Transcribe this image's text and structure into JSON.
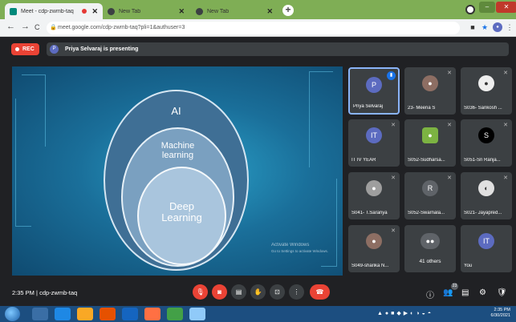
{
  "browser": {
    "tabs": [
      {
        "title": "Meet - cdp-zwmb-taq",
        "active": true
      },
      {
        "title": "New Tab",
        "active": false
      },
      {
        "title": "New Tab",
        "active": false
      }
    ],
    "new_tab_glyph": "+",
    "url": "meet.google.com/cdp-zwmb-taq?pli=1&authuser=3",
    "nav": {
      "back": "←",
      "forward": "→",
      "reload": "C"
    }
  },
  "meet": {
    "rec_label": "REC",
    "presenter_initial": "P",
    "presenting_text": "Priya Selvaraj is presenting",
    "time": "2:35 PM",
    "divider": "|",
    "meeting_code": "cdp-zwmb-taq",
    "people_count": "23",
    "accent": "#ea4335"
  },
  "slide": {
    "labels": {
      "outer": "AI",
      "middle_l1": "Machine",
      "middle_l2": "learning",
      "inner_l1": "Deep",
      "inner_l2": "Learning"
    },
    "watermark_title": "Activate Windows",
    "watermark_sub": "Go to Settings to activate Windows."
  },
  "participants": [
    {
      "name": "Priya Selvaraj",
      "initial": "P",
      "avatar_color": "#5c6bc0",
      "speaking": true
    },
    {
      "name": "23- Meena S",
      "initial": "",
      "avatar_color": "#8d6e63",
      "speaking": false
    },
    {
      "name": "S036- Sankosh ...",
      "initial": "",
      "avatar_color": "#eeeeee",
      "speaking": false
    },
    {
      "name": "IT IV YEAR",
      "initial": "IT",
      "avatar_color": "#5c6bc0",
      "speaking": false
    },
    {
      "name": "S052-Sudharsa...",
      "initial": "",
      "avatar_color": "#7cb342",
      "speaking": false
    },
    {
      "name": "S051-Sri Ranja...",
      "initial": "S",
      "avatar_color": "#000000",
      "speaking": false
    },
    {
      "name": "S041- T.Saranya",
      "initial": "",
      "avatar_color": "#9e9e9e",
      "speaking": false
    },
    {
      "name": "S052-Swarnala...",
      "initial": "R",
      "avatar_color": "#5f6368",
      "speaking": false
    },
    {
      "name": "S021- Jayapred...",
      "initial": "",
      "avatar_color": "#e0e0e0",
      "speaking": false
    },
    {
      "name": "S049-sharika N...",
      "initial": "",
      "avatar_color": "#8d6e63",
      "speaking": false
    },
    {
      "name": "41 others",
      "initial": "",
      "avatar_color": "#5f6368",
      "speaking": false
    },
    {
      "name": "You",
      "initial": "IT",
      "avatar_color": "#5c6bc0",
      "speaking": false
    }
  ],
  "taskbar": {
    "clock_time": "2:35 PM",
    "clock_date": "6/30/2021"
  }
}
